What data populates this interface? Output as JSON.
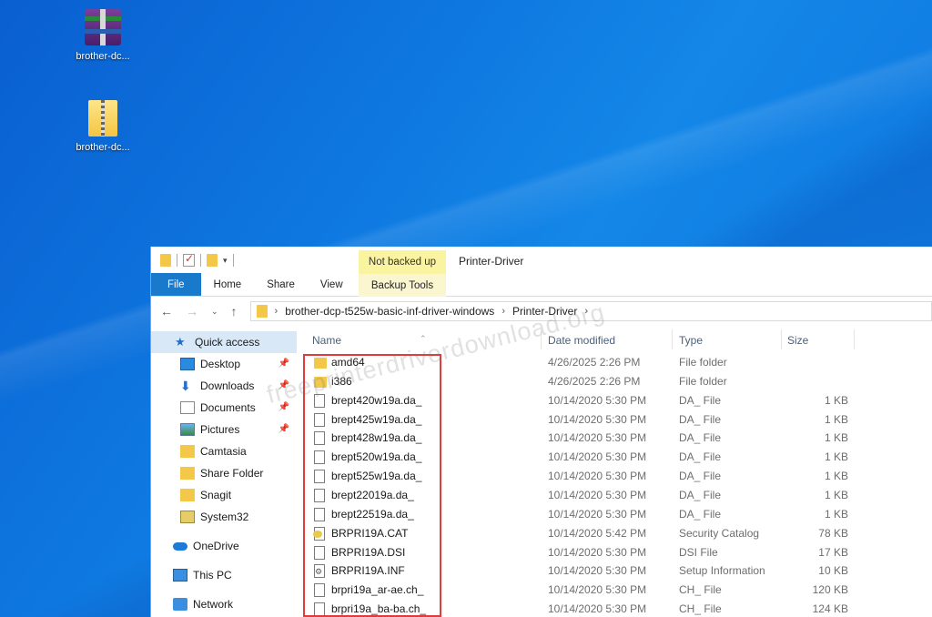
{
  "desktop": {
    "icons": [
      {
        "label": "brother-dc..."
      },
      {
        "label": "brother-dc..."
      }
    ]
  },
  "explorer": {
    "title": "Printer-Driver",
    "context_tab_group": "Not backed up",
    "ribbon_tabs": [
      "File",
      "Home",
      "Share",
      "View"
    ],
    "context_tab": "Backup Tools",
    "address": {
      "segments": [
        "brother-dcp-t525w-basic-inf-driver-windows",
        "Printer-Driver"
      ]
    },
    "nav": {
      "quick_access": "Quick access",
      "items": [
        "Desktop",
        "Downloads",
        "Documents",
        "Pictures",
        "Camtasia",
        "Share Folder",
        "Snagit",
        "System32"
      ],
      "onedrive": "OneDrive",
      "thispc": "This PC",
      "network": "Network"
    },
    "columns": [
      "Name",
      "Date modified",
      "Type",
      "Size"
    ],
    "files": [
      {
        "name": "amd64",
        "date": "4/26/2025 2:26 PM",
        "type": "File folder",
        "size": "",
        "icon": "folder-icon"
      },
      {
        "name": "i386",
        "date": "4/26/2025 2:26 PM",
        "type": "File folder",
        "size": "",
        "icon": "folder-icon"
      },
      {
        "name": "brept420w19a.da_",
        "date": "10/14/2020 5:30 PM",
        "type": "DA_ File",
        "size": "1 KB",
        "icon": "file-icon"
      },
      {
        "name": "brept425w19a.da_",
        "date": "10/14/2020 5:30 PM",
        "type": "DA_ File",
        "size": "1 KB",
        "icon": "file-icon"
      },
      {
        "name": "brept428w19a.da_",
        "date": "10/14/2020 5:30 PM",
        "type": "DA_ File",
        "size": "1 KB",
        "icon": "file-icon"
      },
      {
        "name": "brept520w19a.da_",
        "date": "10/14/2020 5:30 PM",
        "type": "DA_ File",
        "size": "1 KB",
        "icon": "file-icon"
      },
      {
        "name": "brept525w19a.da_",
        "date": "10/14/2020 5:30 PM",
        "type": "DA_ File",
        "size": "1 KB",
        "icon": "file-icon"
      },
      {
        "name": "brept22019a.da_",
        "date": "10/14/2020 5:30 PM",
        "type": "DA_ File",
        "size": "1 KB",
        "icon": "file-icon"
      },
      {
        "name": "brept22519a.da_",
        "date": "10/14/2020 5:30 PM",
        "type": "DA_ File",
        "size": "1 KB",
        "icon": "file-icon"
      },
      {
        "name": "BRPRI19A.CAT",
        "date": "10/14/2020 5:42 PM",
        "type": "Security Catalog",
        "size": "78 KB",
        "icon": "catalog-icon"
      },
      {
        "name": "BRPRI19A.DSI",
        "date": "10/14/2020 5:30 PM",
        "type": "DSI File",
        "size": "17 KB",
        "icon": "file-icon"
      },
      {
        "name": "BRPRI19A.INF",
        "date": "10/14/2020 5:30 PM",
        "type": "Setup Information",
        "size": "10 KB",
        "icon": "setup-info-icon"
      },
      {
        "name": "brpri19a_ar-ae.ch_",
        "date": "10/14/2020 5:30 PM",
        "type": "CH_ File",
        "size": "120 KB",
        "icon": "file-icon"
      },
      {
        "name": "brpri19a_ba-ba.ch_",
        "date": "10/14/2020 5:30 PM",
        "type": "CH_ File",
        "size": "124 KB",
        "icon": "file-icon"
      }
    ]
  },
  "watermark": "freeprinterdriverdownload.org",
  "colors": {
    "highlight": "#e23b3b",
    "file_tab": "#1979ca",
    "context_tab": "#faf3a0"
  }
}
